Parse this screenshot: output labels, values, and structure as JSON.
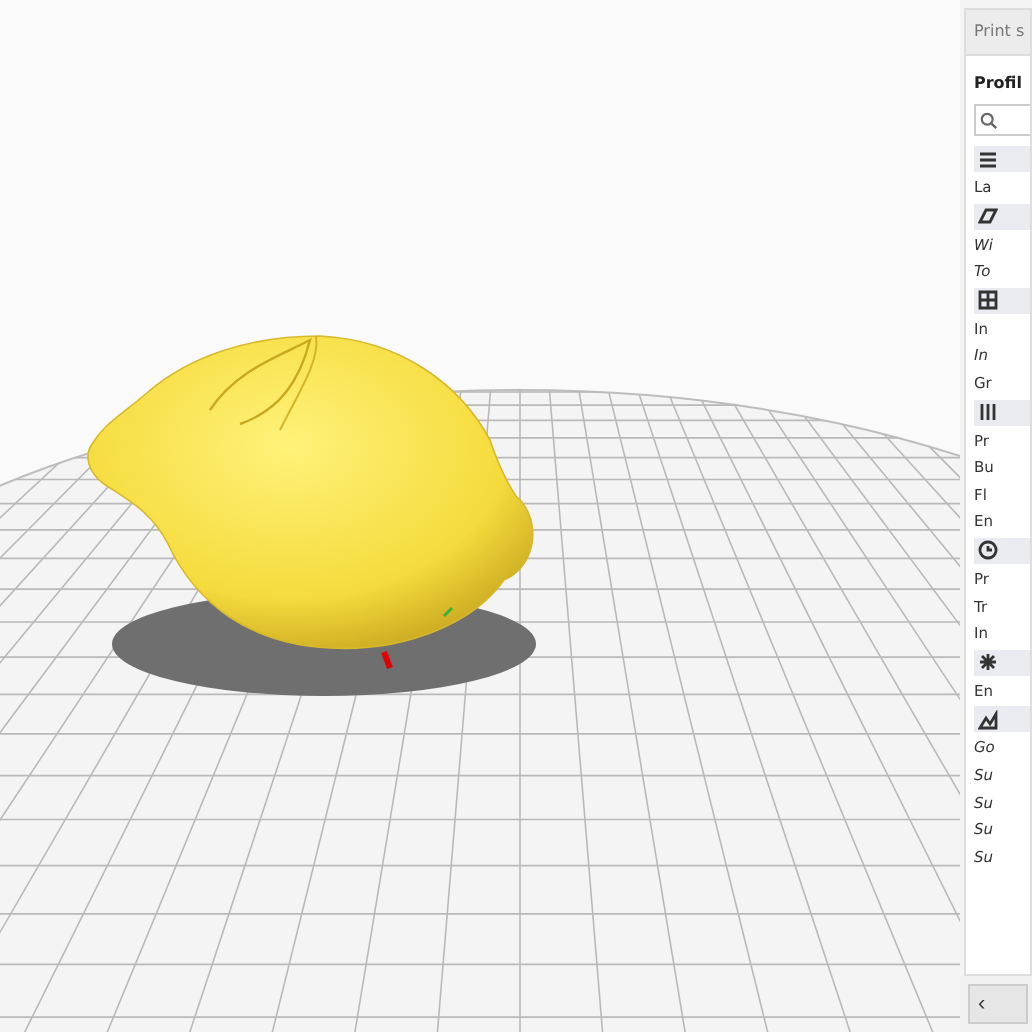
{
  "sidebar": {
    "tab": "Print s",
    "title": "Profil",
    "rows": [
      {
        "kind": "section"
      },
      {
        "kind": "setting",
        "label": "La",
        "modified": false
      },
      {
        "kind": "section"
      },
      {
        "kind": "setting",
        "label": "Wi",
        "modified": true
      },
      {
        "kind": "setting",
        "label": "To",
        "modified": true
      },
      {
        "kind": "section"
      },
      {
        "kind": "setting",
        "label": "In",
        "modified": false
      },
      {
        "kind": "setting",
        "label": "In",
        "modified": true
      },
      {
        "kind": "setting",
        "label": "Gr",
        "modified": false
      },
      {
        "kind": "section"
      },
      {
        "kind": "setting",
        "label": "Pr",
        "modified": false
      },
      {
        "kind": "setting",
        "label": "Bu",
        "modified": false
      },
      {
        "kind": "setting",
        "label": "Fl",
        "modified": false
      },
      {
        "kind": "setting",
        "label": "En",
        "modified": false
      },
      {
        "kind": "section"
      },
      {
        "kind": "setting",
        "label": "Pr",
        "modified": false
      },
      {
        "kind": "setting",
        "label": "Tr",
        "modified": false
      },
      {
        "kind": "setting",
        "label": "In",
        "modified": false
      },
      {
        "kind": "section"
      },
      {
        "kind": "setting",
        "label": "En",
        "modified": false
      },
      {
        "kind": "section"
      },
      {
        "kind": "setting",
        "label": "Go",
        "modified": true
      },
      {
        "kind": "setting",
        "label": "Su",
        "modified": true
      },
      {
        "kind": "setting",
        "label": "Su",
        "modified": true
      },
      {
        "kind": "setting",
        "label": "Su",
        "modified": true
      },
      {
        "kind": "setting",
        "label": "Su",
        "modified": true
      }
    ],
    "back_button": "‹"
  }
}
